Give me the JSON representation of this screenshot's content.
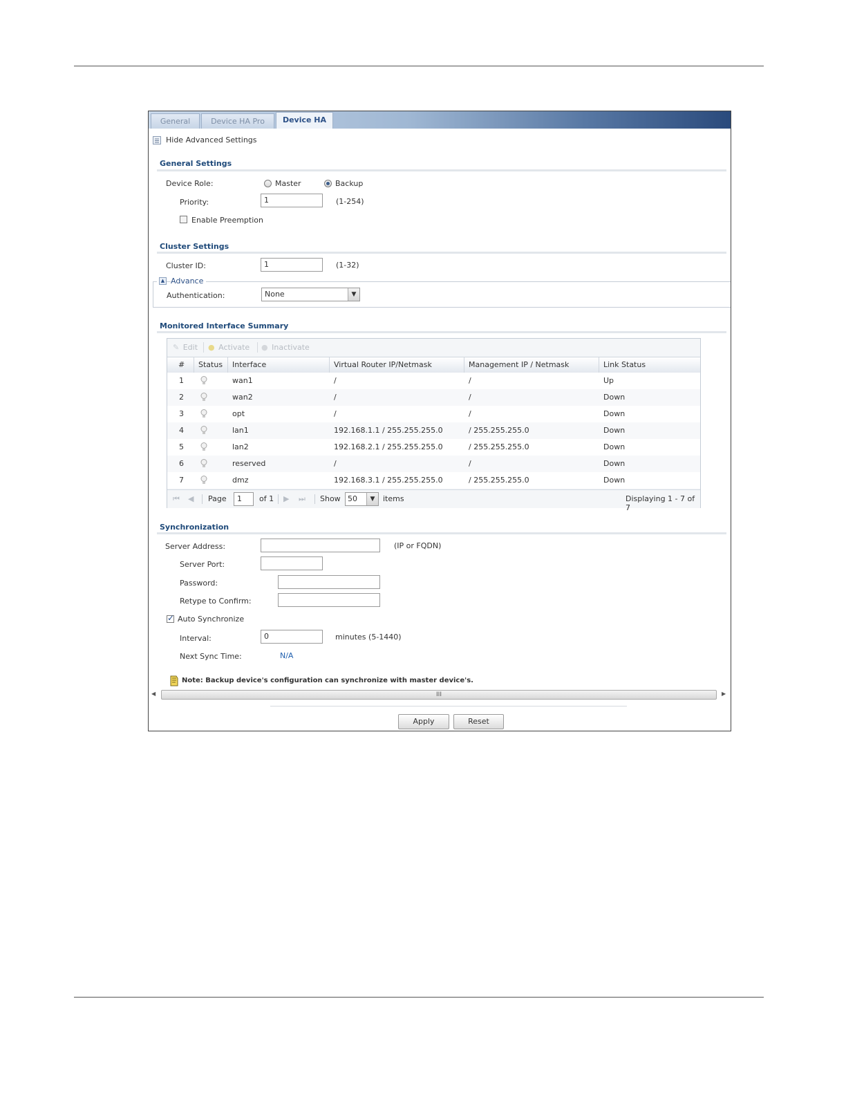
{
  "tabs": [
    {
      "label": "General"
    },
    {
      "label": "Device HA Pro"
    },
    {
      "label": "Device HA"
    }
  ],
  "advanced_toggle": "Hide Advanced Settings",
  "general": {
    "title": "General Settings",
    "device_role_label": "Device Role:",
    "role_master": "Master",
    "role_backup": "Backup",
    "selected_role": "Backup",
    "priority_label": "Priority:",
    "priority_value": "1",
    "priority_hint": "(1-254)",
    "preemption_label": "Enable Preemption",
    "preemption_checked": false
  },
  "cluster": {
    "title": "Cluster Settings",
    "id_label": "Cluster ID:",
    "id_value": "1",
    "id_hint": "(1-32)",
    "advance_label": "Advance",
    "auth_label": "Authentication:",
    "auth_value": "None"
  },
  "monitored": {
    "title": "Monitored Interface Summary",
    "toolbar": {
      "edit": "Edit",
      "activate": "Activate",
      "inactivate": "Inactivate"
    },
    "columns": [
      "#",
      "Status",
      "Interface",
      "Virtual Router IP/Netmask",
      "Management IP / Netmask",
      "Link Status"
    ],
    "rows": [
      {
        "num": "1",
        "interface": "wan1",
        "vrip": "/",
        "mgmt": "/",
        "link": "Up"
      },
      {
        "num": "2",
        "interface": "wan2",
        "vrip": "/",
        "mgmt": "/",
        "link": "Down"
      },
      {
        "num": "3",
        "interface": "opt",
        "vrip": "/",
        "mgmt": "/",
        "link": "Down"
      },
      {
        "num": "4",
        "interface": "lan1",
        "vrip": "192.168.1.1 / 255.255.255.0",
        "mgmt": "/ 255.255.255.0",
        "link": "Down"
      },
      {
        "num": "5",
        "interface": "lan2",
        "vrip": "192.168.2.1 / 255.255.255.0",
        "mgmt": "/ 255.255.255.0",
        "link": "Down"
      },
      {
        "num": "6",
        "interface": "reserved",
        "vrip": "/",
        "mgmt": "/",
        "link": "Down"
      },
      {
        "num": "7",
        "interface": "dmz",
        "vrip": "192.168.3.1 / 255.255.255.0",
        "mgmt": "/ 255.255.255.0",
        "link": "Down"
      }
    ],
    "pager": {
      "page_label": "Page",
      "page_value": "1",
      "of_label": "of 1",
      "show_label": "Show",
      "show_value": "50",
      "items_label": "items",
      "displaying": "Displaying 1 - 7 of 7"
    }
  },
  "sync": {
    "title": "Synchronization",
    "server_address_label": "Server Address:",
    "server_address_value": "",
    "server_address_hint": "(IP or FQDN)",
    "server_port_label": "Server Port:",
    "server_port_value": "",
    "password_label": "Password:",
    "retype_label": "Retype to Confirm:",
    "auto_sync_label": "Auto Synchronize",
    "auto_sync_checked": true,
    "interval_label": "Interval:",
    "interval_value": "0",
    "interval_hint": "minutes (5-1440)",
    "next_sync_label": "Next Sync Time:",
    "next_sync_value": "N/A"
  },
  "note": "Note: Backup device's configuration can synchronize with master device's.",
  "scroll_grip": "III",
  "buttons": {
    "apply": "Apply",
    "reset": "Reset"
  },
  "colors": {
    "section_title": "#1f4a7a",
    "tab_active_text": "#2d5187",
    "next_sync_value": "#1f5fae"
  }
}
